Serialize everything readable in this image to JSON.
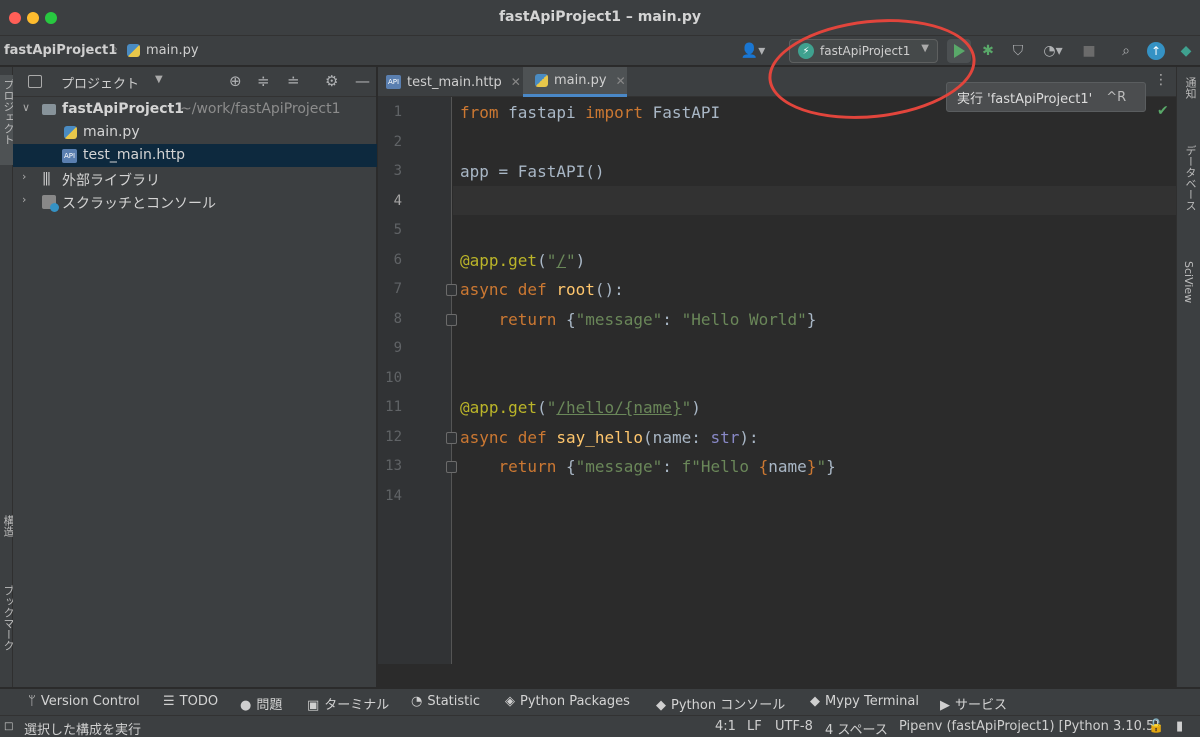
{
  "window": {
    "title": "fastApiProject1 – main.py"
  },
  "breadcrumb": {
    "project": "fastApiProject1",
    "file": "main.py"
  },
  "toolbar": {
    "run_config": "fastApiProject1",
    "tooltip": "実行 'fastApiProject1'",
    "tooltip_shortcut": "^R"
  },
  "project_panel": {
    "title": "プロジェクト",
    "tree": [
      {
        "label": "fastApiProject1",
        "path": "~/work/fastApiProject1"
      },
      {
        "label": "main.py"
      },
      {
        "label": "test_main.http"
      },
      {
        "label": "外部ライブラリ"
      },
      {
        "label": "スクラッチとコンソール"
      }
    ]
  },
  "tabs": [
    {
      "label": "test_main.http"
    },
    {
      "label": "main.py"
    }
  ],
  "editor": {
    "line_numbers": [
      "1",
      "2",
      "3",
      "4",
      "5",
      "6",
      "7",
      "8",
      "9",
      "10",
      "11",
      "12",
      "13",
      "14"
    ],
    "current_line": 4
  },
  "left_strip": {
    "project": "プロジェクト",
    "structure": "構造",
    "bookmarks": "ブックマーク"
  },
  "right_strip": {
    "notifications": "通知",
    "database": "データベース",
    "sciview": "SciView"
  },
  "bottom_tools": [
    "Version Control",
    "TODO",
    "問題",
    "ターミナル",
    "Statistic",
    "Python Packages",
    "Python コンソール",
    "Mypy Terminal",
    "サービス"
  ],
  "status": {
    "message": "選択した構成を実行",
    "position": "4:1",
    "line_sep": "LF",
    "encoding": "UTF-8",
    "indent": "4 スペース",
    "interpreter": "Pipenv (fastApiProject1) [Python 3.10.5]"
  },
  "colors": {
    "accent": "#4a88c7",
    "run_green": "#59a869",
    "annotation_red": "#e2453c"
  }
}
